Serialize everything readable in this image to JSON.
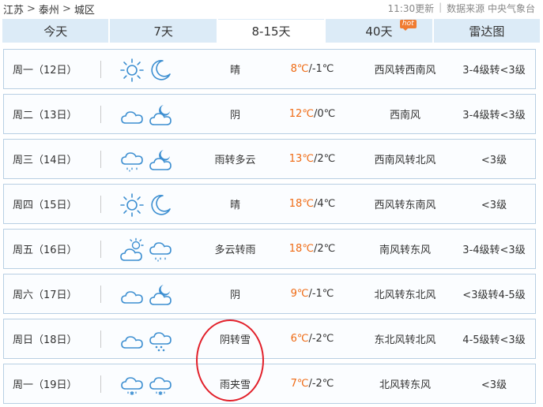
{
  "breadcrumb": {
    "province": "江苏",
    "city": "泰州",
    "district": "城区",
    "separator": ">"
  },
  "meta": {
    "updated": "11:30更新",
    "source": "数据来源 中央气象台"
  },
  "tabs": [
    {
      "label": "今天"
    },
    {
      "label": "7天"
    },
    {
      "label": "8-15天",
      "active": true
    },
    {
      "label": "40天",
      "badge": "hot"
    },
    {
      "label": "雷达图"
    }
  ],
  "temp_separator": "/",
  "colors": {
    "high_temp": "#ef6a13",
    "tab_bg": "#dcebf7",
    "row_border": "#b8cfe3",
    "annotation": "#e2202a"
  },
  "forecast": [
    {
      "day": "周一（12日）",
      "icon_day": "sunny-icon",
      "icon_night": "clear-night-icon",
      "condition": "晴",
      "high": "8℃",
      "low": "-1℃",
      "wind": "西风转西南风",
      "level": "3-4级转<3级"
    },
    {
      "day": "周二（13日）",
      "icon_day": "overcast-icon",
      "icon_night": "cloudy-night-icon",
      "condition": "阴",
      "high": "12℃",
      "low": "0℃",
      "wind": "西南风",
      "level": "3-4级转<3级"
    },
    {
      "day": "周三（14日）",
      "icon_day": "rain-icon",
      "icon_night": "cloudy-night-icon",
      "condition": "雨转多云",
      "high": "13℃",
      "low": "2℃",
      "wind": "西南风转北风",
      "level": "<3级"
    },
    {
      "day": "周四（15日）",
      "icon_day": "sunny-icon",
      "icon_night": "clear-night-icon",
      "condition": "晴",
      "high": "18℃",
      "low": "4℃",
      "wind": "西风转东南风",
      "level": "<3级"
    },
    {
      "day": "周五（16日）",
      "icon_day": "partly-cloudy-icon",
      "icon_night": "rain-icon",
      "condition": "多云转雨",
      "high": "18℃",
      "low": "2℃",
      "wind": "南风转东风",
      "level": "3-4级转<3级"
    },
    {
      "day": "周六（17日）",
      "icon_day": "overcast-icon",
      "icon_night": "cloudy-night-icon",
      "condition": "阴",
      "high": "9℃",
      "low": "-1℃",
      "wind": "北风转东北风",
      "level": "<3级转4-5级"
    },
    {
      "day": "周日（18日）",
      "icon_day": "overcast-icon",
      "icon_night": "snow-icon",
      "condition": "阴转雪",
      "high": "6℃",
      "low": "-2℃",
      "wind": "东北风转北风",
      "level": "4-5级转<3级"
    },
    {
      "day": "周一（19日）",
      "icon_day": "sleet-icon",
      "icon_night": "sleet-icon",
      "condition": "雨夹雪",
      "high": "7℃",
      "low": "-2℃",
      "wind": "北风转东风",
      "level": "<3级"
    }
  ]
}
